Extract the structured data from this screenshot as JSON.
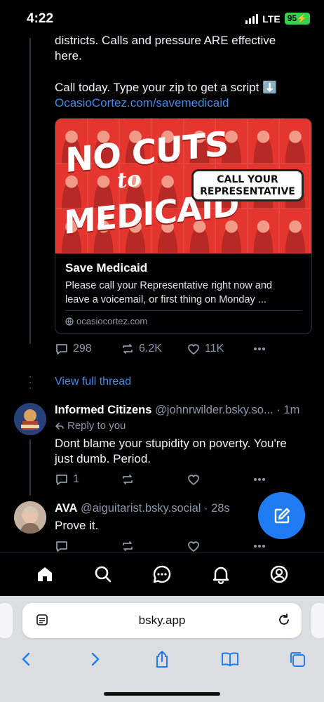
{
  "status_bar": {
    "time": "4:22",
    "network": "LTE",
    "battery": "95"
  },
  "post": {
    "text_line1": "districts. Calls and pressure ARE effective",
    "text_line2": "here.",
    "text_line3": "Call today. Type your zip to get a script ⬇️",
    "link": "OcasioCortez.com/savemedicaid",
    "embed": {
      "image_text": {
        "no_cuts": "NO CUTS",
        "to": "to",
        "medicaid": "MEDICAID",
        "call_line1": "CALL YOUR",
        "call_line2": "REPRESENTATIVE"
      },
      "title": "Save Medicaid",
      "description_line1": "Please call your Representative right now and",
      "description_line2": "leave a voicemail, or first thing on Monday ...",
      "domain": "ocasiocortez.com"
    },
    "replies_count": "298",
    "reposts_count": "6.2K",
    "likes_count": "11K"
  },
  "view_full_thread": "View full thread",
  "reply1": {
    "author": "Informed Citizens",
    "handle": "@johnrwilder.bsky.so...",
    "time": "· 1m",
    "reply_to": "Reply to you",
    "text_line1": "Dont blame your stupidity on poverty. You're",
    "text_line2": "just dumb. Period.",
    "replies_count": "1"
  },
  "reply2": {
    "author": "AVA",
    "handle": "@aiguitarist.bsky.social",
    "time": "· 28s",
    "text": "Prove it."
  },
  "browser": {
    "url": "bsky.app"
  },
  "colors": {
    "accent": "#3d8bf0",
    "fab": "#1f7cf3",
    "battery": "#3ad04d",
    "muted": "#8b98a9"
  }
}
